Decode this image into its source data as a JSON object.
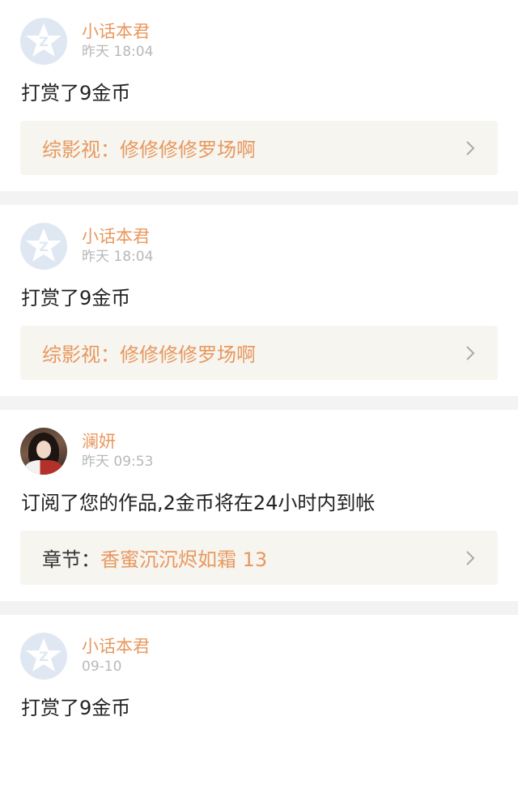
{
  "colors": {
    "accent": "#e8985e",
    "time_gray": "#b8b8b8",
    "ref_bg": "#f6f5f0",
    "divider": "#f3f3f3"
  },
  "items": [
    {
      "username": "小话本君",
      "time": "昨天 18:04",
      "message": "打赏了9金币",
      "ref_prefix": "综影视：",
      "ref_title": "修修修修罗场啊",
      "avatar": "default-avatar-icon"
    },
    {
      "username": "小话本君",
      "time": "昨天 18:04",
      "message": "打赏了9金币",
      "ref_prefix": "综影视：",
      "ref_title": "修修修修罗场啊",
      "avatar": "default-avatar-icon"
    },
    {
      "username": "澜妍",
      "time": "昨天 09:53",
      "message": "订阅了您的作品,2金币将在24小时内到帐",
      "ref_prefix": "章节：",
      "ref_title": "香蜜沉沉烬如霜 13",
      "avatar": "user-photo-avatar"
    },
    {
      "username": "小话本君",
      "time": "09-10",
      "message": "打赏了9金币",
      "avatar": "default-avatar-icon"
    }
  ]
}
